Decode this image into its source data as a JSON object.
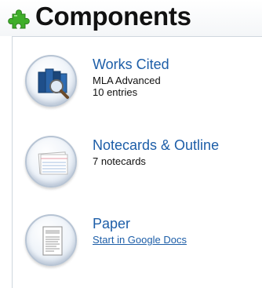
{
  "header": {
    "title": "Components"
  },
  "items": [
    {
      "title": "Works Cited",
      "line1": "MLA Advanced",
      "line2": "10 entries"
    },
    {
      "title": "Notecards & Outline",
      "line1": "7 notecards"
    },
    {
      "title": "Paper",
      "link": "Start in Google Docs"
    }
  ],
  "icons": {
    "header": "puzzle-piece-icon",
    "works_cited": "books-magnifier-icon",
    "notecards": "notecards-icon",
    "paper": "paper-document-icon"
  },
  "colors": {
    "link": "#1d5ea8",
    "puzzle": "#3fae2a"
  }
}
